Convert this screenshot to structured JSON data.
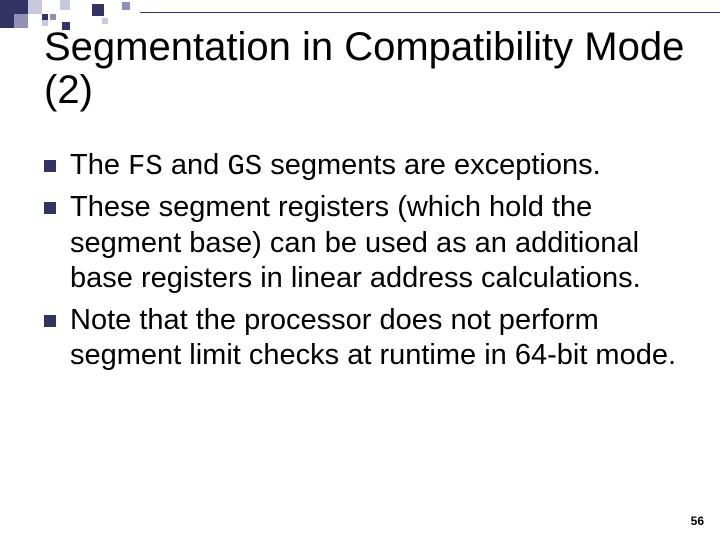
{
  "title": "Segmentation in Compatibility Mode (2)",
  "bullets": [
    {
      "pre": "The ",
      "c1": "FS",
      "mid": " and ",
      "c2": "GS",
      "post": " segments are exceptions."
    },
    {
      "text": "These segment registers (which hold the segment base) can be used as an additional base registers in linear address calculations."
    },
    {
      "text": "Note that the processor does not perform segment limit checks at runtime in 64-bit mode."
    }
  ],
  "page_number": "56"
}
